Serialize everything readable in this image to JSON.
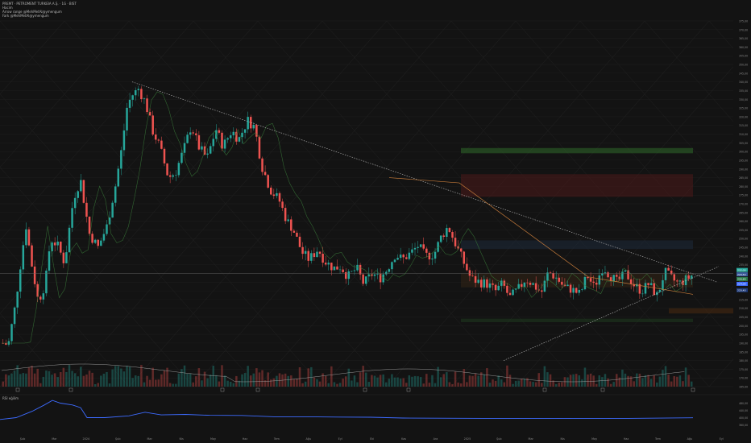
{
  "header": {
    "title": "PREMT · PETROMENT TURKEIA A.Ş. · 1G · BIST",
    "line2": "Hacim",
    "line3": "Arrow range @MehMetAl@ymengum",
    "line4": "Fark @MehMetAl@ymengum",
    "unit_button": "TRY"
  },
  "indicator": {
    "label": "RSI eğilim"
  },
  "colors": {
    "background": "#131313",
    "up": "#26a69a",
    "down": "#ef5350",
    "indicator_line": "#3d6bff",
    "trendline": "#8a8a8a",
    "ma_line": "#c47a3a"
  },
  "chart_data": [
    {
      "type": "candlestick",
      "x_ticks": [
        "Şub",
        "Mar",
        "2024",
        "Şub",
        "Mar",
        "Nis",
        "May",
        "Haz",
        "Tem",
        "Ağu",
        "Eyl",
        "Eki",
        "Kas",
        "Ara",
        "2025",
        "Şub",
        "Mar",
        "Nis",
        "May",
        "Haz",
        "Tem",
        "Ağu",
        "Eyl"
      ],
      "y_ticks": [
        "165,00",
        "170,00",
        "175,00",
        "180,00",
        "185,00",
        "190,00",
        "195,00",
        "200,00",
        "205,00",
        "210,00",
        "215,00",
        "220,00",
        "225,00",
        "230,00",
        "235,00",
        "240,00",
        "245,00",
        "250,00",
        "255,00",
        "260,00",
        "265,00",
        "270,00",
        "275,00",
        "280,00",
        "285,00",
        "290,00",
        "295,00",
        "300,00",
        "305,00",
        "310,00",
        "315,00",
        "320,00",
        "325,00",
        "330,00",
        "335,00",
        "340,00",
        "345,00",
        "350,00",
        "355,00",
        "360,00",
        "365,00",
        "370,00",
        "375,00"
      ],
      "ylim": [
        165,
        375
      ],
      "anchors": [
        [
          0,
          190
        ],
        [
          3,
          189
        ],
        [
          7,
          212
        ],
        [
          10,
          236
        ],
        [
          13,
          258
        ],
        [
          16,
          237
        ],
        [
          20,
          214
        ],
        [
          24,
          224
        ],
        [
          27,
          250
        ],
        [
          31,
          246
        ],
        [
          35,
          236
        ],
        [
          40,
          273
        ],
        [
          44,
          284
        ],
        [
          49,
          253
        ],
        [
          54,
          245
        ],
        [
          59,
          257
        ],
        [
          64,
          281
        ],
        [
          68,
          305
        ],
        [
          70,
          324
        ],
        [
          73,
          332
        ],
        [
          77,
          336
        ],
        [
          81,
          328
        ],
        [
          85,
          312
        ],
        [
          89,
          303
        ],
        [
          94,
          285
        ],
        [
          98,
          288
        ],
        [
          103,
          302
        ],
        [
          107,
          315
        ],
        [
          111,
          303
        ],
        [
          116,
          296
        ],
        [
          121,
          313
        ],
        [
          125,
          303
        ],
        [
          130,
          312
        ],
        [
          134,
          307
        ],
        [
          139,
          318
        ],
        [
          143,
          314
        ],
        [
          147,
          292
        ],
        [
          152,
          278
        ],
        [
          157,
          272
        ],
        [
          161,
          261
        ],
        [
          165,
          255
        ],
        [
          170,
          242
        ],
        [
          174,
          238
        ],
        [
          179,
          244
        ],
        [
          183,
          237
        ],
        [
          188,
          233
        ],
        [
          192,
          234
        ],
        [
          196,
          228
        ],
        [
          201,
          233
        ],
        [
          205,
          224
        ],
        [
          210,
          230
        ],
        [
          214,
          227
        ],
        [
          218,
          232
        ],
        [
          223,
          241
        ],
        [
          227,
          238
        ],
        [
          232,
          242
        ],
        [
          236,
          246
        ],
        [
          240,
          240
        ],
        [
          245,
          241
        ],
        [
          249,
          251
        ],
        [
          253,
          257
        ],
        [
          258,
          245
        ],
        [
          262,
          236
        ],
        [
          266,
          227
        ],
        [
          271,
          225
        ],
        [
          275,
          224
        ],
        [
          280,
          220
        ],
        [
          284,
          224
        ],
        [
          288,
          216
        ],
        [
          293,
          221
        ],
        [
          297,
          227
        ],
        [
          301,
          224
        ],
        [
          306,
          219
        ],
        [
          310,
          231
        ],
        [
          315,
          227
        ],
        [
          319,
          222
        ],
        [
          323,
          221
        ],
        [
          328,
          218
        ],
        [
          332,
          229
        ],
        [
          336,
          222
        ],
        [
          341,
          234
        ],
        [
          345,
          229
        ],
        [
          349,
          225
        ],
        [
          354,
          230
        ],
        [
          359,
          223
        ],
        [
          363,
          220
        ],
        [
          367,
          224
        ],
        [
          372,
          217
        ],
        [
          376,
          231
        ],
        [
          380,
          227
        ],
        [
          384,
          224
        ],
        [
          389,
          227
        ],
        [
          393,
          230
        ]
      ],
      "volume_label": "Hacim",
      "last_values": [
        "232,00",
        "229,50",
        "226,80",
        "224,00",
        "220,40"
      ]
    },
    {
      "type": "line",
      "title": "RSI eğilim",
      "y_ticks": [
        "480,00",
        "440,00",
        "400,00",
        "360,00"
      ],
      "ylim": [
        340,
        500
      ]
    }
  ]
}
